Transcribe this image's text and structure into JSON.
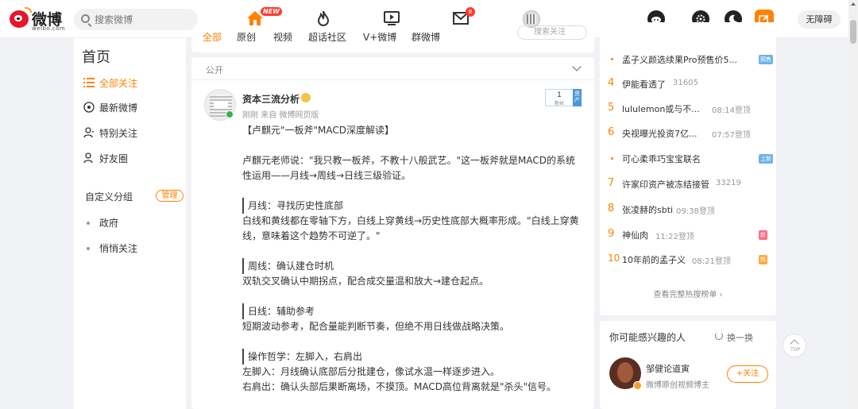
{
  "header": {
    "logo_text": "微博",
    "logo_sub": "weibo.com",
    "search_placeholder": "搜索微博",
    "new_badge": "NEW",
    "message_count": "8",
    "accessibility_label": "无障碍"
  },
  "sidebar": {
    "title": "首页",
    "items": [
      {
        "label": "全部关注",
        "icon": "list-icon",
        "active": true
      },
      {
        "label": "最新微博",
        "icon": "clock-icon"
      },
      {
        "label": "特别关注",
        "icon": "user-icon"
      },
      {
        "label": "好友圈",
        "icon": "friends-icon"
      }
    ],
    "group_title": "自定义分组",
    "manage_label": "管理",
    "groups": [
      "政府",
      "悄悄关注"
    ]
  },
  "tabs": {
    "items": [
      "全部",
      "原创",
      "视频",
      "超话社区",
      "V+微博",
      "群微博"
    ],
    "search_placeholder": "搜索关注"
  },
  "post": {
    "visibility": "公开",
    "author": "资本三流分析",
    "meta": "刚刚  来自 微博网页版",
    "fan_count": "1",
    "fan_label": "粉丝",
    "fan_side": "资产",
    "lines": [
      "【卢麒元\"一板斧\"MACD深度解读】",
      "",
      "卢麒元老师说：\"我只教一板斧，不教十八般武艺。\"这一板斧就是MACD的系统",
      "性运用——月线→周线→日线三级验证。",
      "",
      "月线：寻找历史性底部",
      "白线和黄线都在零轴下方，白线上穿黄线→历史性底部大概率形成。\"白线上穿黄",
      "线，意味着这个趋势不可逆了。\"",
      "",
      "周线：确认建仓时机",
      "双轨交叉确认中期拐点，配合成交量温和放大→建仓起点。",
      "",
      "日线：辅助参考",
      "短期波动参考，配合量能判断节奏，但绝不用日线做战略决策。",
      "",
      "操作哲学：左脚入，右肩出",
      "左脚入：月线确认底部后分批建仓，像试水温一样逐步进入。",
      "右肩出：确认头部后果断离场，不摸顶。MACD高位背离就是\"杀头\"信号。"
    ]
  },
  "hot": {
    "items": [
      {
        "rank": "",
        "title": "孟子义颜选续果Pro预售价5...",
        "meta": "",
        "tag": "预售",
        "tag_color": "#6fb3e8"
      },
      {
        "rank": "4",
        "title": "伊能看透了",
        "meta": "31605",
        "tag": "",
        "tag_color": ""
      },
      {
        "rank": "5",
        "title": "lululemon或与不...",
        "meta": "08:14登顶",
        "tag": "",
        "tag_color": ""
      },
      {
        "rank": "6",
        "title": "央视曝光投资7亿...",
        "meta": "07:57登顶",
        "tag": "",
        "tag_color": ""
      },
      {
        "rank": "",
        "title": "可心柔乖巧宝宝联名",
        "meta": "",
        "tag": "上新",
        "tag_color": "#6fb3e8"
      },
      {
        "rank": "7",
        "title": "许家印资产被冻结接管",
        "meta": "33219",
        "tag": "",
        "tag_color": ""
      },
      {
        "rank": "8",
        "title": "张凌赫的sbti",
        "meta": "09:38登顶",
        "tag": "",
        "tag_color": ""
      },
      {
        "rank": "9",
        "title": "神仙肉",
        "meta": "11:22登顶",
        "tag": "新",
        "tag_color": "#ff6b81"
      },
      {
        "rank": "10",
        "title": "10年前的孟子义",
        "meta": "08:21登顶",
        "tag": "热",
        "tag_color": "#ffa940"
      }
    ],
    "more_label": "查看完整热搜榜单"
  },
  "recommend": {
    "title": "你可能感兴趣的人",
    "switch_label": "换一换",
    "user_name": "邹健论道寅",
    "user_desc": "微博原创视频博主",
    "follow_label": "+关注"
  },
  "top_label": "TOP"
}
